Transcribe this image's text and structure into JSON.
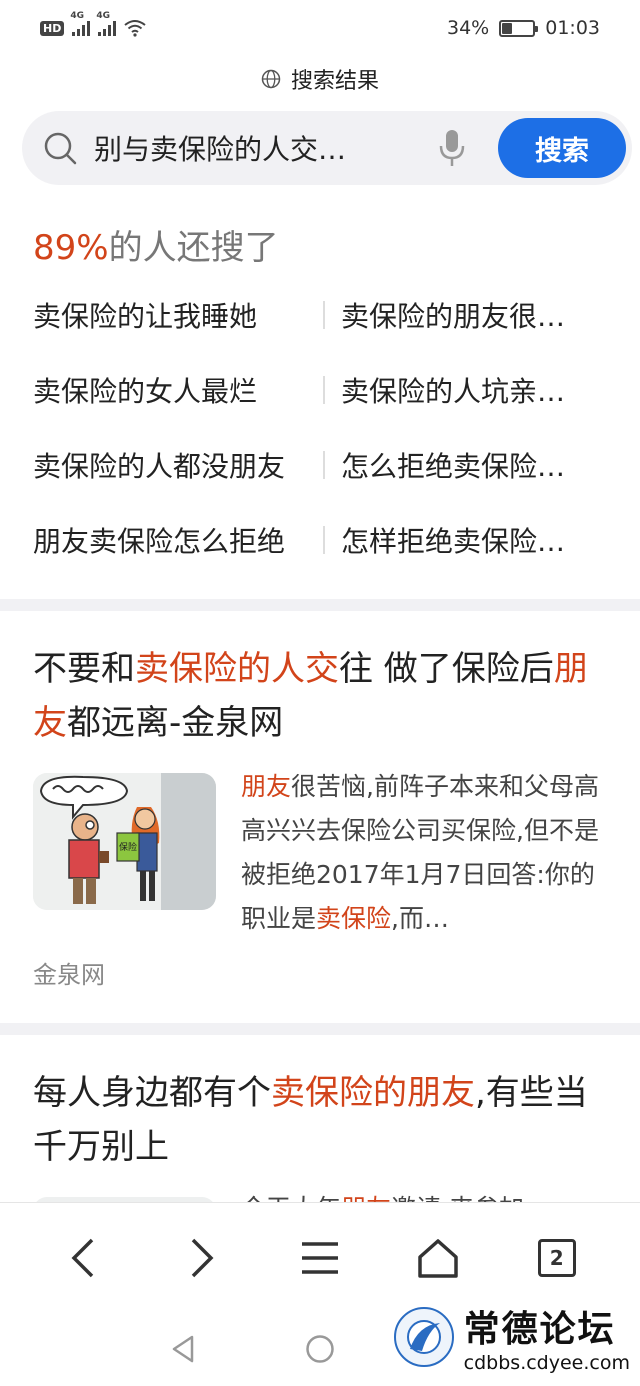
{
  "status_bar": {
    "hd_label": "HD",
    "network_1": "4G",
    "network_2": "4G",
    "battery_percent": "34%",
    "battery_level": 0.34,
    "time": "01:03"
  },
  "header": {
    "title": "搜索结果",
    "icon": "globe-icon"
  },
  "search": {
    "query": "别与卖保险的人交…",
    "button_label": "搜索",
    "accent": "#1d6fe6"
  },
  "related": {
    "percent": "89%",
    "heading_rest": "的人还搜了",
    "items": [
      "卖保险的让我睡她",
      "卖保险的朋友很…",
      "卖保险的女人最烂",
      "卖保险的人坑亲…",
      "卖保险的人都没朋友",
      "怎么拒绝卖保险…",
      "朋友卖保险怎么拒绝",
      "怎样拒绝卖保险…"
    ]
  },
  "results": [
    {
      "title_parts": [
        "不要和",
        "卖保险的人交",
        "往 做了保险后",
        "朋友",
        "都远离-金泉网"
      ],
      "snippet_parts": [
        "朋友",
        "很苦恼,前阵子本来和父母高高兴兴去保险公司买保险,但不是被拒绝2017年1月7日回答:你的职业是",
        "卖保险",
        ",而…"
      ],
      "thumb_sign": "保险",
      "source": "金泉网"
    },
    {
      "title_parts": [
        "每人身边都有个",
        "卖保险的朋友",
        ",有些当千万别上"
      ],
      "snippet_parts": [
        "今天大年",
        "朋友",
        "邀请 来参加"
      ]
    }
  ],
  "bottom_nav": {
    "tab_count": "2"
  },
  "watermark": {
    "title": "常德论坛",
    "url": "cdbbs.cdyee.com"
  },
  "colors": {
    "highlight": "#d2441a",
    "gray_text": "#888888",
    "divider": "#f1f1f4"
  }
}
